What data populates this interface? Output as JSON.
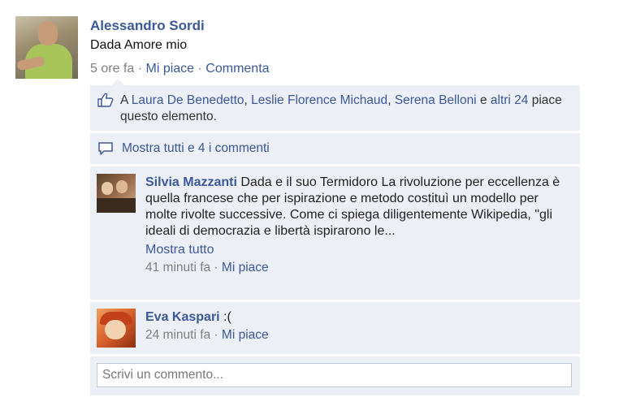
{
  "post": {
    "author": "Alessandro Sordi",
    "text": "Dada Amore mio",
    "time": "5 ore fa",
    "dot": " · ",
    "like_label": "Mi piace",
    "comment_label": "Commenta"
  },
  "likes": {
    "prefix": "A ",
    "people": [
      "Laura De Benedetto",
      "Leslie Florence Michaud",
      "Serena Belloni"
    ],
    "comma": ", ",
    "and": " e ",
    "others": "altri 24",
    "suffix": " piace questo elemento."
  },
  "show_all": {
    "label": "Mostra tutti e 4 i commenti"
  },
  "comments": [
    {
      "author": "Silvia Mazzanti",
      "text": " Dada e il suo Termidoro La rivoluzione per eccellenza è quella francese che per ispirazione e metodo costituì un modello per molte rivolte successive. Come ci spiega diligentemente Wikipedia, \"gli ideali di democrazia e libertà ispirarono le...",
      "more": "Mostra tutto",
      "time": "41 minuti fa",
      "dot": " · ",
      "like_label": "Mi piace"
    },
    {
      "author": "Eva Kaspari",
      "text": " :(",
      "time": "24 minuti fa",
      "dot": " · ",
      "like_label": "Mi piace"
    }
  ],
  "comment_input": {
    "placeholder": "Scrivi un commento..."
  },
  "colors": {
    "link": "#3b5998",
    "block_bg": "#eceff5",
    "meta": "#808080"
  },
  "icons": {
    "likes": "thumbs-up-icon",
    "show_all": "speech-bubble-icon"
  }
}
